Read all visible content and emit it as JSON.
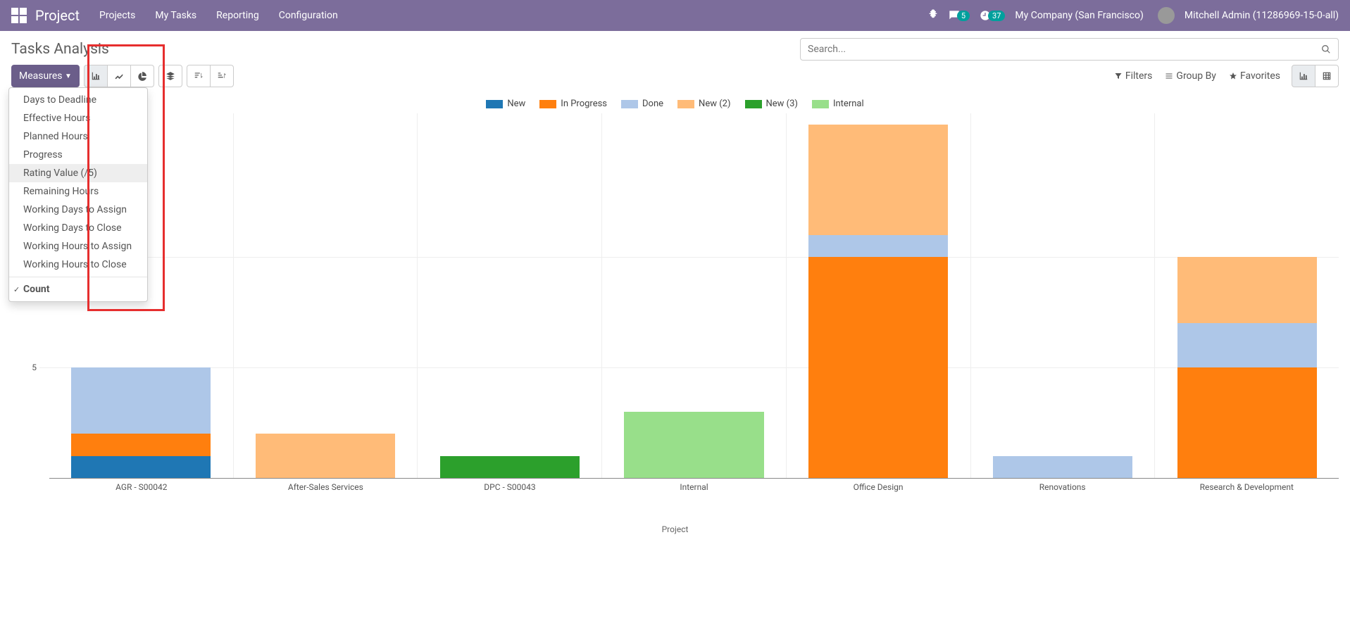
{
  "header": {
    "app_name": "Project",
    "menu": [
      "Projects",
      "My Tasks",
      "Reporting",
      "Configuration"
    ],
    "company": "My Company (San Francisco)",
    "user": "Mitchell Admin (11286969-15-0-all)",
    "msg_count": "5",
    "activity_count": "37"
  },
  "page_title": "Tasks Analysis",
  "search": {
    "placeholder": "Search..."
  },
  "toolbar": {
    "measures_label": "Measures",
    "filters": "Filters",
    "group_by": "Group By",
    "favorites": "Favorites"
  },
  "measures_menu": {
    "items": [
      "Days to Deadline",
      "Effective Hours",
      "Planned Hours",
      "Progress",
      "Rating Value (/5)",
      "Remaining Hours",
      "Working Days to Assign",
      "Working Days to Close",
      "Working Hours to Assign",
      "Working Hours to Close"
    ],
    "hovered_index": 4,
    "count_label": "Count"
  },
  "chart_data": {
    "type": "bar",
    "stacked": true,
    "xlabel": "Project",
    "ylabel": "Count",
    "ylim": [
      0,
      16.5
    ],
    "yticks": [
      5,
      10
    ],
    "categories": [
      "AGR - S00042",
      "After-Sales Services",
      "DPC - S00043",
      "Internal",
      "Office Design",
      "Renovations",
      "Research & Development"
    ],
    "series": [
      {
        "name": "New",
        "color": "#1f77b4",
        "values": [
          1,
          0,
          0,
          0,
          0,
          0,
          0
        ]
      },
      {
        "name": "In Progress",
        "color": "#ff7f0e",
        "values": [
          1,
          0,
          0,
          0,
          10,
          0,
          5
        ]
      },
      {
        "name": "Done",
        "color": "#aec7e8",
        "values": [
          3,
          0,
          0,
          0,
          1,
          1,
          2
        ]
      },
      {
        "name": "New (2)",
        "color": "#ffbb78",
        "values": [
          0,
          2,
          0,
          0,
          5,
          0,
          3
        ]
      },
      {
        "name": "New (3)",
        "color": "#2ca02c",
        "values": [
          0,
          0,
          1,
          0,
          0,
          0,
          0
        ]
      },
      {
        "name": "Internal",
        "color": "#98df8a",
        "values": [
          0,
          0,
          0,
          3,
          0,
          0,
          0
        ]
      }
    ]
  }
}
